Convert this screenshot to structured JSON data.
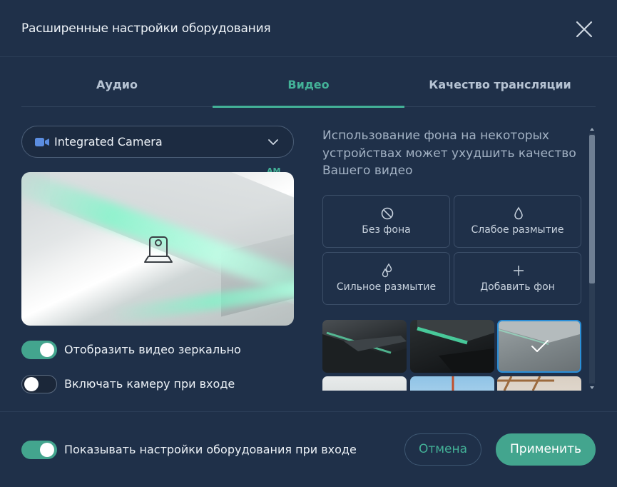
{
  "dialog": {
    "title": "Расширенные настройки оборудования"
  },
  "tabs": [
    {
      "label": "Аудио",
      "active": false
    },
    {
      "label": "Видео",
      "active": true
    },
    {
      "label": "Качество трансляции",
      "active": false
    }
  ],
  "camera": {
    "selected": "Integrated Camera",
    "corner_mark": "AM"
  },
  "toggles": {
    "mirror": {
      "label": "Отобразить видео зеркально",
      "on": true
    },
    "camera_on_join": {
      "label": "Включать камеру при входе",
      "on": false
    },
    "show_settings_on_join": {
      "label": "Показывать настройки оборудования при входе",
      "on": true
    }
  },
  "background": {
    "hint": "Использование фона на некоторых устройствах может ухудшить качество Вашего видео",
    "options": [
      {
        "label": "Без фона",
        "icon": "no-background-icon"
      },
      {
        "label": "Слабое размытие",
        "icon": "light-blur-icon"
      },
      {
        "label": "Сильное размытие",
        "icon": "strong-blur-icon"
      },
      {
        "label": "Добавить фон",
        "icon": "plus-icon"
      }
    ],
    "selected_thumbnail": 3
  },
  "buttons": {
    "cancel": "Отмена",
    "apply": "Применить"
  },
  "colors": {
    "accent": "#43b197",
    "background": "#1f3049",
    "selected_border": "#2a8fd8"
  }
}
